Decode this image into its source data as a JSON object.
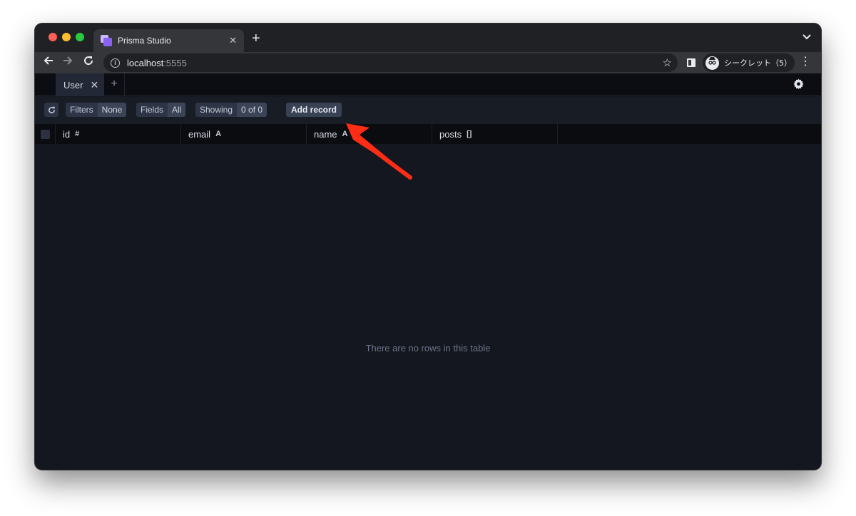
{
  "browser": {
    "tab_title": "Prisma Studio",
    "tab_close": "✕",
    "new_tab": "+",
    "url_host": "localhost",
    "url_port": ":5555",
    "profile_label": "シークレット（5）",
    "icons": {
      "back": "back-arrow-icon",
      "forward": "forward-arrow-icon",
      "reload": "reload-icon",
      "info": "info-icon",
      "star": "bookmark-star-icon",
      "side_panel": "side-panel-icon",
      "incognito": "incognito-icon",
      "menu": "kebab-menu-icon",
      "tab_list": "chevron-down-icon"
    }
  },
  "studio": {
    "tabs": [
      {
        "label": "User",
        "close": "✕"
      }
    ],
    "add_tab": "+",
    "toolbar": {
      "filters_label": "Filters",
      "filters_value": "None",
      "fields_label": "Fields",
      "fields_value": "All",
      "showing_label": "Showing",
      "showing_value": "0 of 0",
      "add_record_label": "Add record"
    },
    "columns": [
      {
        "name": "id",
        "type_icon": "#"
      },
      {
        "name": "email",
        "type_icon": "A"
      },
      {
        "name": "name",
        "type_icon": "A"
      },
      {
        "name": "posts",
        "type_icon": "[]"
      }
    ],
    "empty_message": "There are no rows in this table"
  },
  "colors": {
    "annotation_arrow": "#ff2d16",
    "app_background": "#14171f",
    "header_background": "#0a0c10"
  }
}
